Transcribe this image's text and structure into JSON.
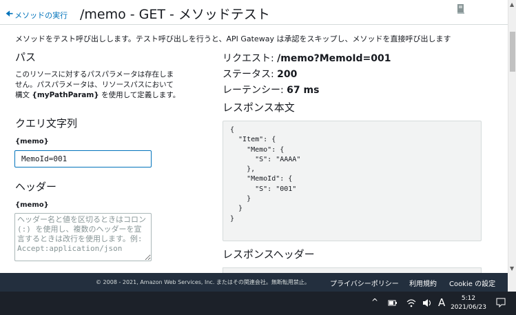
{
  "header": {
    "back_label": "メソッドの実行",
    "title": "/memo - GET - メソッドテスト"
  },
  "description": "メソッドをテスト呼び出しします。テスト呼び出しを行うと、API Gateway は承認をスキップし、メソッドを直接呼び出します",
  "path": {
    "heading": "パス",
    "text_line1": "このリソースに対するパスパラメータは存在しま",
    "text_line2": "せん。パスパラメータは、リソースパスにおいて",
    "text_line3_pre": "構文 ",
    "text_line3_code": "{myPathParam}",
    "text_line3_post": " を使用して定義します。"
  },
  "query": {
    "heading": "クエリ文字列",
    "label": "{memo}",
    "value": "MemoId=001"
  },
  "headers": {
    "heading": "ヘッダー",
    "label": "{memo}",
    "placeholder": "ヘッダー名と値を区切るときはコロン (:) を使用し、複数のヘッダーを宣言するときは改行を使用します。例: Accept:application/json"
  },
  "result": {
    "request_label": "リクエスト: ",
    "request_value": "/memo?MemoId=001",
    "status_label": "ステータス: ",
    "status_value": "200",
    "latency_label": "レーテンシー: ",
    "latency_value": "67 ms",
    "body_heading": "レスポンス本文",
    "body": "{\n  \"Item\": {\n    \"Memo\": {\n      \"S\": \"AAAA\"\n    },\n    \"MemoId\": {\n      \"S\": \"001\"\n    }\n  }\n}",
    "headers_heading": "レスポンスヘッダー"
  },
  "footer": {
    "copyright": "© 2008 - 2021, Amazon Web Services, Inc. またはその関連会社。無断転用禁止。",
    "privacy": "プライバシーポリシー",
    "terms": "利用規約",
    "cookie": "Cookie の設定"
  },
  "taskbar": {
    "chevron": "^",
    "ime": "A",
    "time": "5:12",
    "date": "2021/06/23"
  },
  "colors": {
    "link": "#0073bb",
    "footer_bg": "#232f3e",
    "taskbar_bg": "#1c2129"
  }
}
